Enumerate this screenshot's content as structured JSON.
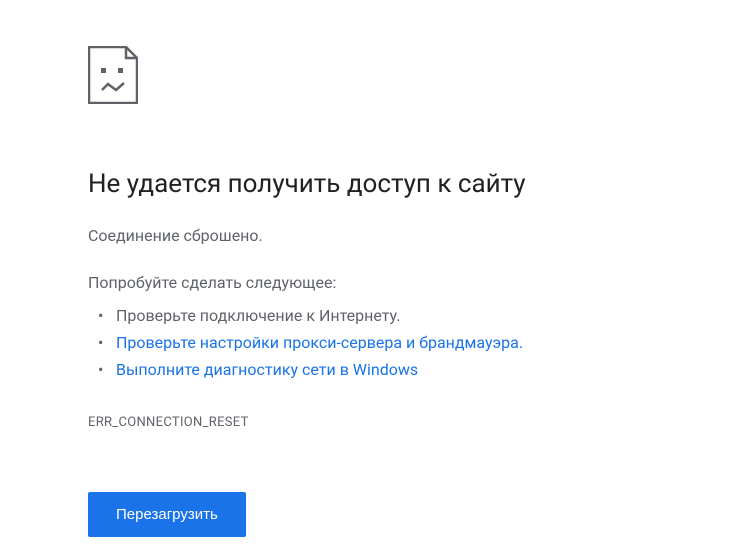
{
  "icon_name": "sad-page-icon",
  "title": "Не удается получить доступ к сайту",
  "subtitle": "Соединение сброшено.",
  "try_label": "Попробуйте сделать следующее:",
  "suggestions": [
    {
      "text": "Проверьте подключение к Интернету.",
      "link": false
    },
    {
      "text": "Проверьте настройки прокси-сервера и брандмауэра.",
      "link": true
    },
    {
      "text": "Выполните диагностику сети в Windows",
      "link": true
    }
  ],
  "error_code": "ERR_CONNECTION_RESET",
  "reload_label": "Перезагрузить"
}
